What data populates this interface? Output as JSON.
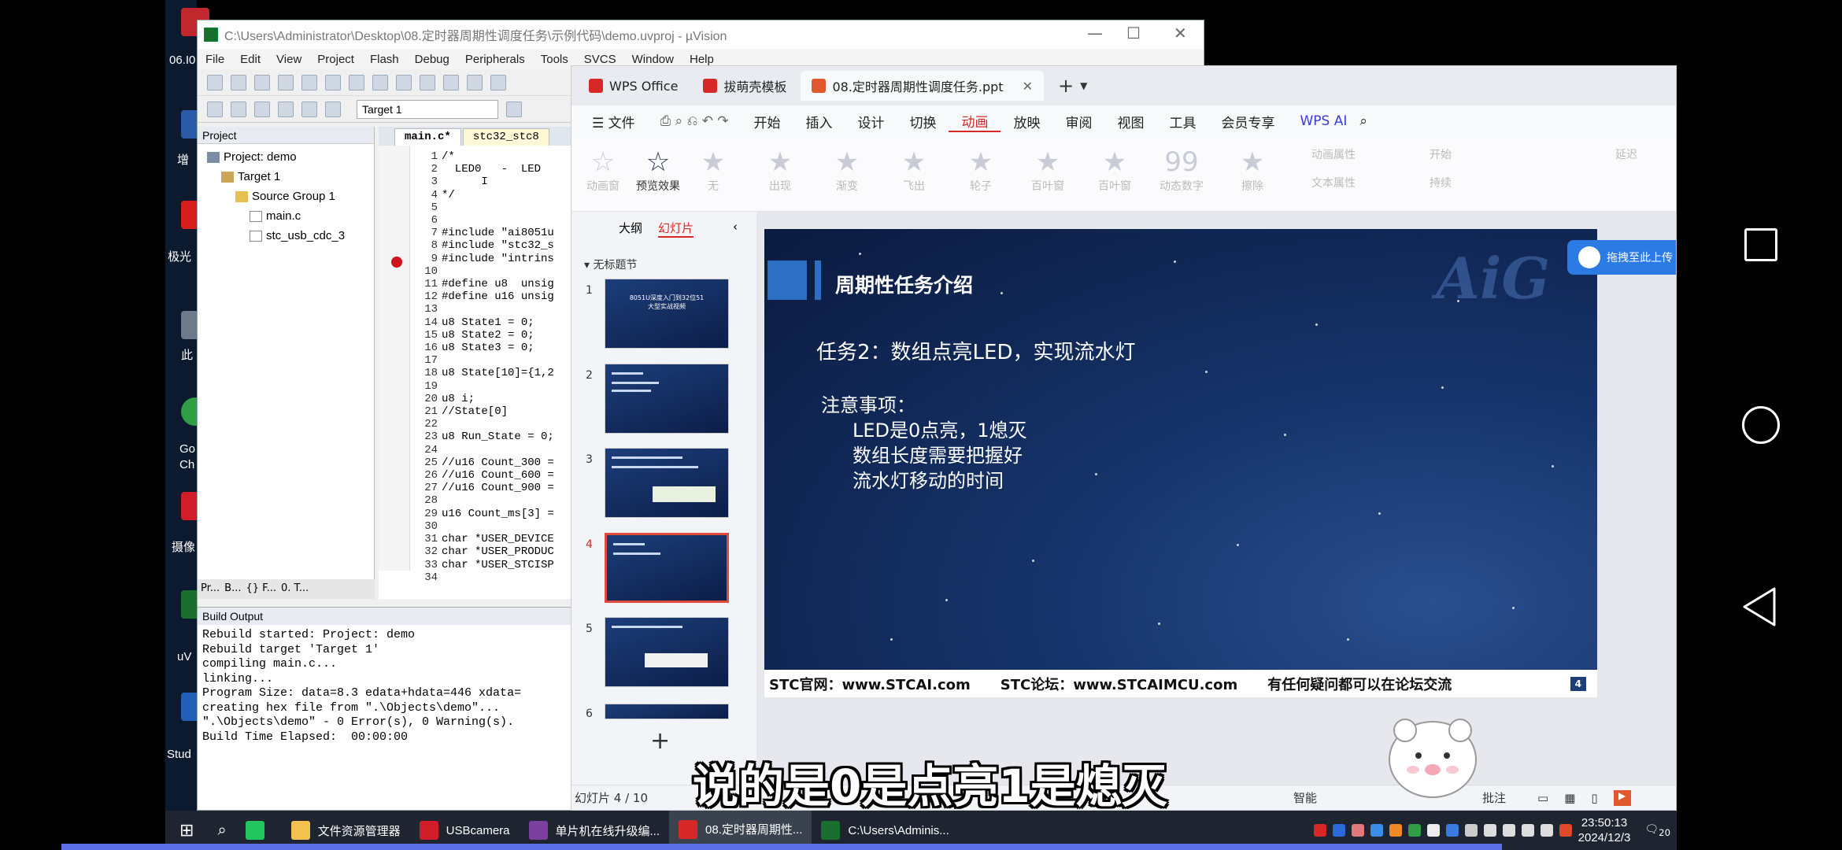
{
  "desktop": {
    "labels": [
      "06.I0",
      "增",
      "极光",
      "此",
      "Go",
      "Ch",
      "摄像",
      "uV",
      "Stud"
    ]
  },
  "keil": {
    "title": "C:\\Users\\Administrator\\Desktop\\08.定时器周期性调度任务\\示例代码\\demo.uvproj - µVision",
    "menu": [
      "File",
      "Edit",
      "View",
      "Project",
      "Flash",
      "Debug",
      "Peripherals",
      "Tools",
      "SVCS",
      "Window",
      "Help"
    ],
    "target_select": "Target 1",
    "project_panel_title": "Project",
    "tree": {
      "root": "Project: demo",
      "target": "Target 1",
      "group": "Source Group 1",
      "file1": "main.c",
      "file2": "stc_usb_cdc_3"
    },
    "proj_tabs": [
      "Pr...",
      "B...",
      "{} F...",
      "0. T..."
    ],
    "editor_tabs": [
      "main.c*",
      "stc32_stc8"
    ],
    "line_numbers": "1\n2\n3\n4\n5\n6\n7\n8\n9\n10\n11\n12\n13\n14\n15\n16\n17\n18\n19\n20\n21\n22\n23\n24\n25\n26\n27\n28\n29\n30\n31\n32\n33\n34",
    "code": "/*\n  LED0   -  LED\n      I\n*/\n\n\n#include \"ai8051u\n#include \"stc32_s\n#include \"intrins\n\n#define u8  unsig\n#define u16 unsig\n\nu8 State1 = 0;\nu8 State2 = 0;\nu8 State3 = 0;\n\nu8 State[10]={1,2\n\nu8 i;\n//State[0]\n\nu8 Run_State = 0;\n\n//u16 Count_300 =\n//u16 Count_600 =\n//u16 Count_900 =\n\nu16 Count_ms[3] =\n\nchar *USER_DEVICE\nchar *USER_PRODUC\nchar *USER_STCISP\n",
    "build_title": "Build Output",
    "build_text": "Rebuild started: Project: demo\nRebuild target 'Target 1'\ncompiling main.c...\nlinking...\nProgram Size: data=8.3 edata+hdata=446 xdata=\ncreating hex file from \".\\Objects\\demo\"...\n\".\\Objects\\demo\" - 0 Error(s), 0 Warning(s).\nBuild Time Elapsed:  00:00:00"
  },
  "wps": {
    "tabs": [
      "WPS Office",
      "拔萌壳模板",
      "08.定时器周期性调度任务.ppt"
    ],
    "file_menu": "文件",
    "menu": [
      "开始",
      "插入",
      "设计",
      "切换",
      "动画",
      "放映",
      "审阅",
      "视图",
      "工具",
      "会员专享"
    ],
    "ai_label": "WPS AI",
    "ribbon": [
      "动画窗",
      "预览效果",
      "无",
      "出现",
      "渐变",
      "飞出",
      "轮子",
      "百叶窗",
      "百叶窗",
      "动态数字",
      "擦除"
    ],
    "ribbon_right": [
      "动画属性",
      "文本属性",
      "开始",
      "持续",
      "延迟"
    ],
    "pane_tabs": [
      "大纲",
      "幻灯片"
    ],
    "section": "无标题节",
    "thumb_numbers": [
      "1",
      "2",
      "3",
      "4",
      "5",
      "6"
    ],
    "thumb1_title": "8051U深度入门到32位51大型实战视频",
    "upload_btn": "拖拽至此上传",
    "slide": {
      "logo": "AiG",
      "title": "周期性任务介绍",
      "task": "任务2：数组点亮LED，实现流水灯",
      "notes_head": "注意事项：",
      "notes": [
        "LED是0点亮，1熄灭",
        "数组长度需要把握好",
        "流水灯移动的时间"
      ],
      "footer1": "STC官网：www.STCAI.com",
      "footer2": "STC论坛：www.STCAIMCU.com",
      "footer3": "有任何疑问都可以在论坛交流",
      "page": "4"
    },
    "status": "幻灯片 4 / 10",
    "status_right": [
      "智能",
      "批注"
    ]
  },
  "taskbar": {
    "items": [
      "文件资源管理器",
      "USBcamera",
      "单片机在线升级编...",
      "08.定时器周期性...",
      "C:\\Users\\Adminis..."
    ],
    "time": "23:50:13",
    "date": "2024/12/3",
    "notif": "20"
  },
  "subtitle": "说的是0是点亮1是熄灭"
}
